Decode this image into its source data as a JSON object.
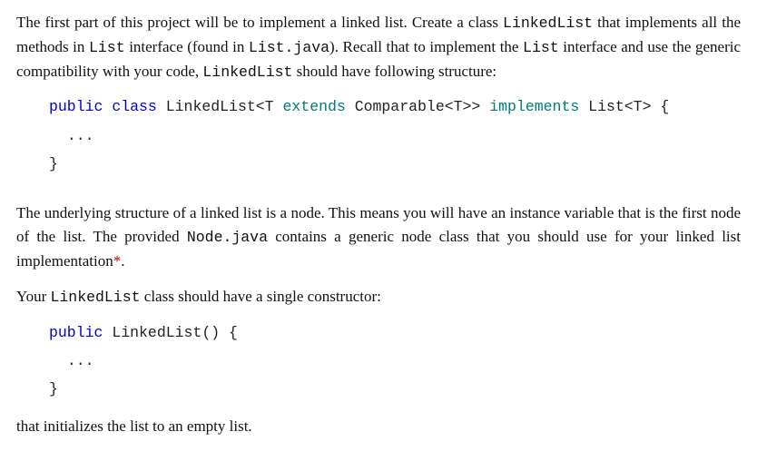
{
  "p1": {
    "t1": "The first part of this project will be to implement a linked list. Create a class ",
    "c1": "LinkedList",
    "t2": " that implements all the methods in ",
    "c2": "List",
    "t3": " interface (found in ",
    "c3": "List.java",
    "t4": "). Recall that to implement the ",
    "c4": "List",
    "t5": " interface and use the generic compatibility with your code, ",
    "c5": "LinkedList",
    "t6": " should have following structure:"
  },
  "code1": {
    "kw_public": "public",
    "kw_class": "class",
    "name": "LinkedList<T",
    "kw_extends": "extends",
    "comp": "Comparable<T>>",
    "kw_implements": "implements",
    "impl": "List<T> {",
    "dots": "...",
    "close": "}"
  },
  "p2": {
    "t1": "The underlying structure of a linked list is a node. This means you will have an instance variable that is the first node of the list. The provided ",
    "c1": "Node.java",
    "t2": " contains a generic node class that you should use for your linked list implementation",
    "ast": "*",
    "t3": "."
  },
  "p3": {
    "t1": "Your ",
    "c1": "LinkedList",
    "t2": " class should have a single constructor:"
  },
  "code2": {
    "kw_public": "public",
    "sig": "LinkedList() {",
    "dots": "...",
    "close": "}"
  },
  "p4": {
    "t1": "that initializes the list to an empty list."
  }
}
